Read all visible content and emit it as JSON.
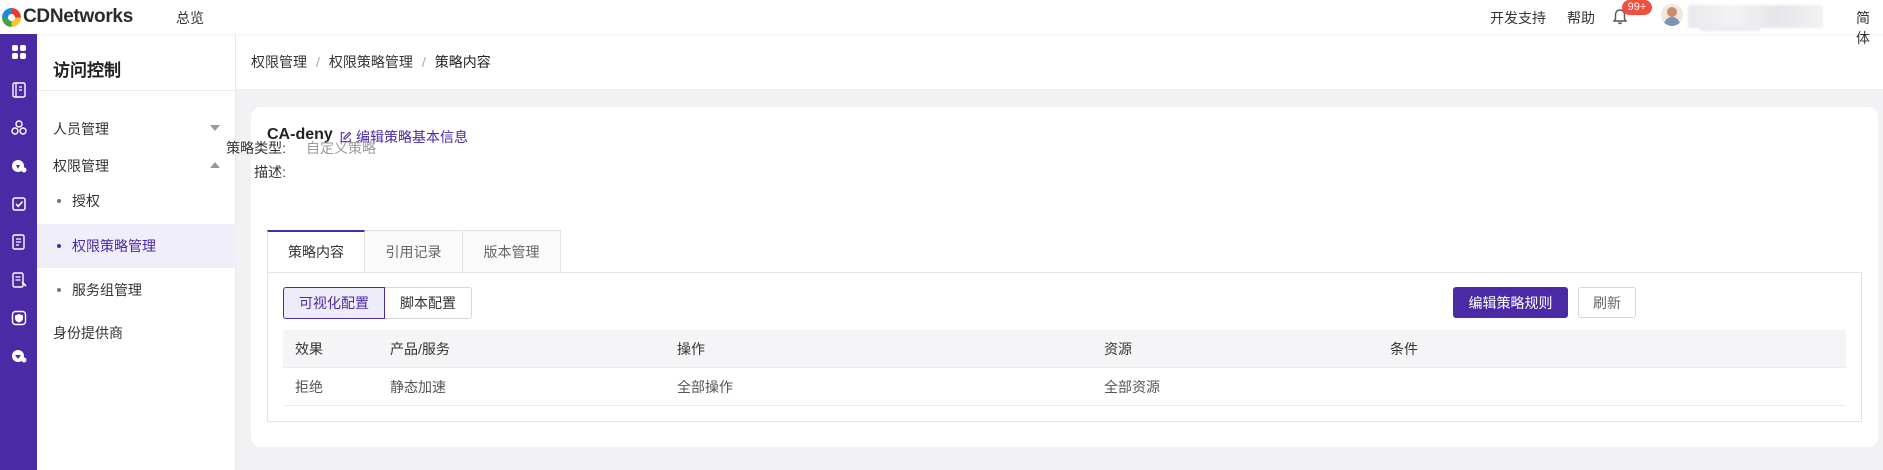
{
  "topbar": {
    "brand": "CDNetworks",
    "nav_overview": "总览",
    "dev_support": "开发支持",
    "help": "帮助",
    "notification_count": "99+",
    "language": "简体"
  },
  "rail": {
    "icons": [
      "apps-icon",
      "book-icon",
      "network-icon",
      "cloud-icon",
      "check-icon",
      "document-icon",
      "report-icon",
      "shield-icon",
      "security-icon"
    ]
  },
  "sidebar": {
    "title": "访问控制",
    "items": [
      {
        "label": "人员管理",
        "expanded": false
      },
      {
        "label": "权限管理",
        "expanded": true
      }
    ],
    "sub_items": [
      {
        "label": "授权",
        "active": false
      },
      {
        "label": "权限策略管理",
        "active": true
      },
      {
        "label": "服务组管理",
        "active": false
      }
    ],
    "identity_provider": "身份提供商"
  },
  "breadcrumb": [
    "权限管理",
    "权限策略管理",
    "策略内容"
  ],
  "policy": {
    "name": "CA-deny",
    "edit_label": "编辑策略基本信息",
    "type_label": "策略类型:",
    "type_value": "自定义策略",
    "desc_label": "描述:",
    "desc_value": ""
  },
  "tabs": [
    {
      "label": "策略内容",
      "active": true
    },
    {
      "label": "引用记录",
      "active": false
    },
    {
      "label": "版本管理",
      "active": false
    }
  ],
  "config_modes": [
    {
      "label": "可视化配置",
      "active": true
    },
    {
      "label": "脚本配置",
      "active": false
    }
  ],
  "actions": {
    "edit_rules": "编辑策略规则",
    "refresh": "刷新"
  },
  "table": {
    "headers": [
      "效果",
      "产品/服务",
      "操作",
      "资源",
      "条件"
    ],
    "rows": [
      [
        "拒绝",
        "静态加速",
        "全部操作",
        "全部资源",
        ""
      ]
    ]
  },
  "colors": {
    "brand": "#4b2aa5",
    "badge": "#f04e3e"
  }
}
